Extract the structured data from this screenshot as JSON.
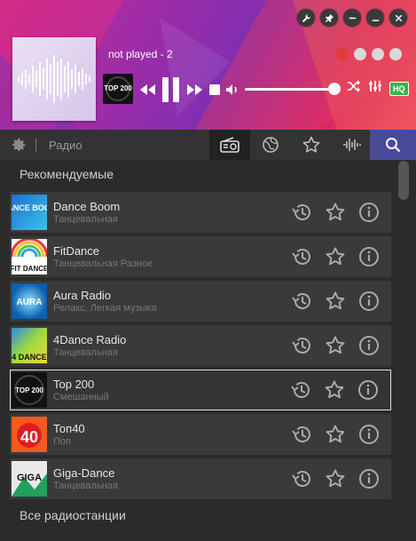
{
  "player": {
    "track": "not played - 2",
    "mini_logo_text": "TOP 200",
    "hq_label": "HQ",
    "volume": 0.92
  },
  "colors": {
    "accent": "#4a4a9a",
    "src_red": "#e23b3b",
    "hq_green": "#3cb44a"
  },
  "toolbar": {
    "label": "Радио",
    "tabs": [
      "radio-icon",
      "globe-icon",
      "star-icon",
      "waveform-icon"
    ],
    "search_icon": "search-icon"
  },
  "section": {
    "recommended": "Рекомендуемые",
    "all": "Все радиостанции"
  },
  "stations": [
    {
      "name": "Dance Boom",
      "genre": "Танцевальная",
      "logo": "DANCE BOOM"
    },
    {
      "name": "FitDance",
      "genre": "Танцевальная Разное",
      "logo": "FIT DANCE"
    },
    {
      "name": "Aura Radio",
      "genre": "Релакс, Легкая музыка",
      "logo": "AURA"
    },
    {
      "name": "4Dance Radio",
      "genre": "Танцевальная",
      "logo": "4 DANCE"
    },
    {
      "name": "Top 200",
      "genre": "Смешанный",
      "logo": "TOP 200"
    },
    {
      "name": "Топ40",
      "genre": "Поп",
      "logo": "40"
    },
    {
      "name": "Giga-Dance",
      "genre": "Танцевальная",
      "logo": "GIGA"
    }
  ]
}
